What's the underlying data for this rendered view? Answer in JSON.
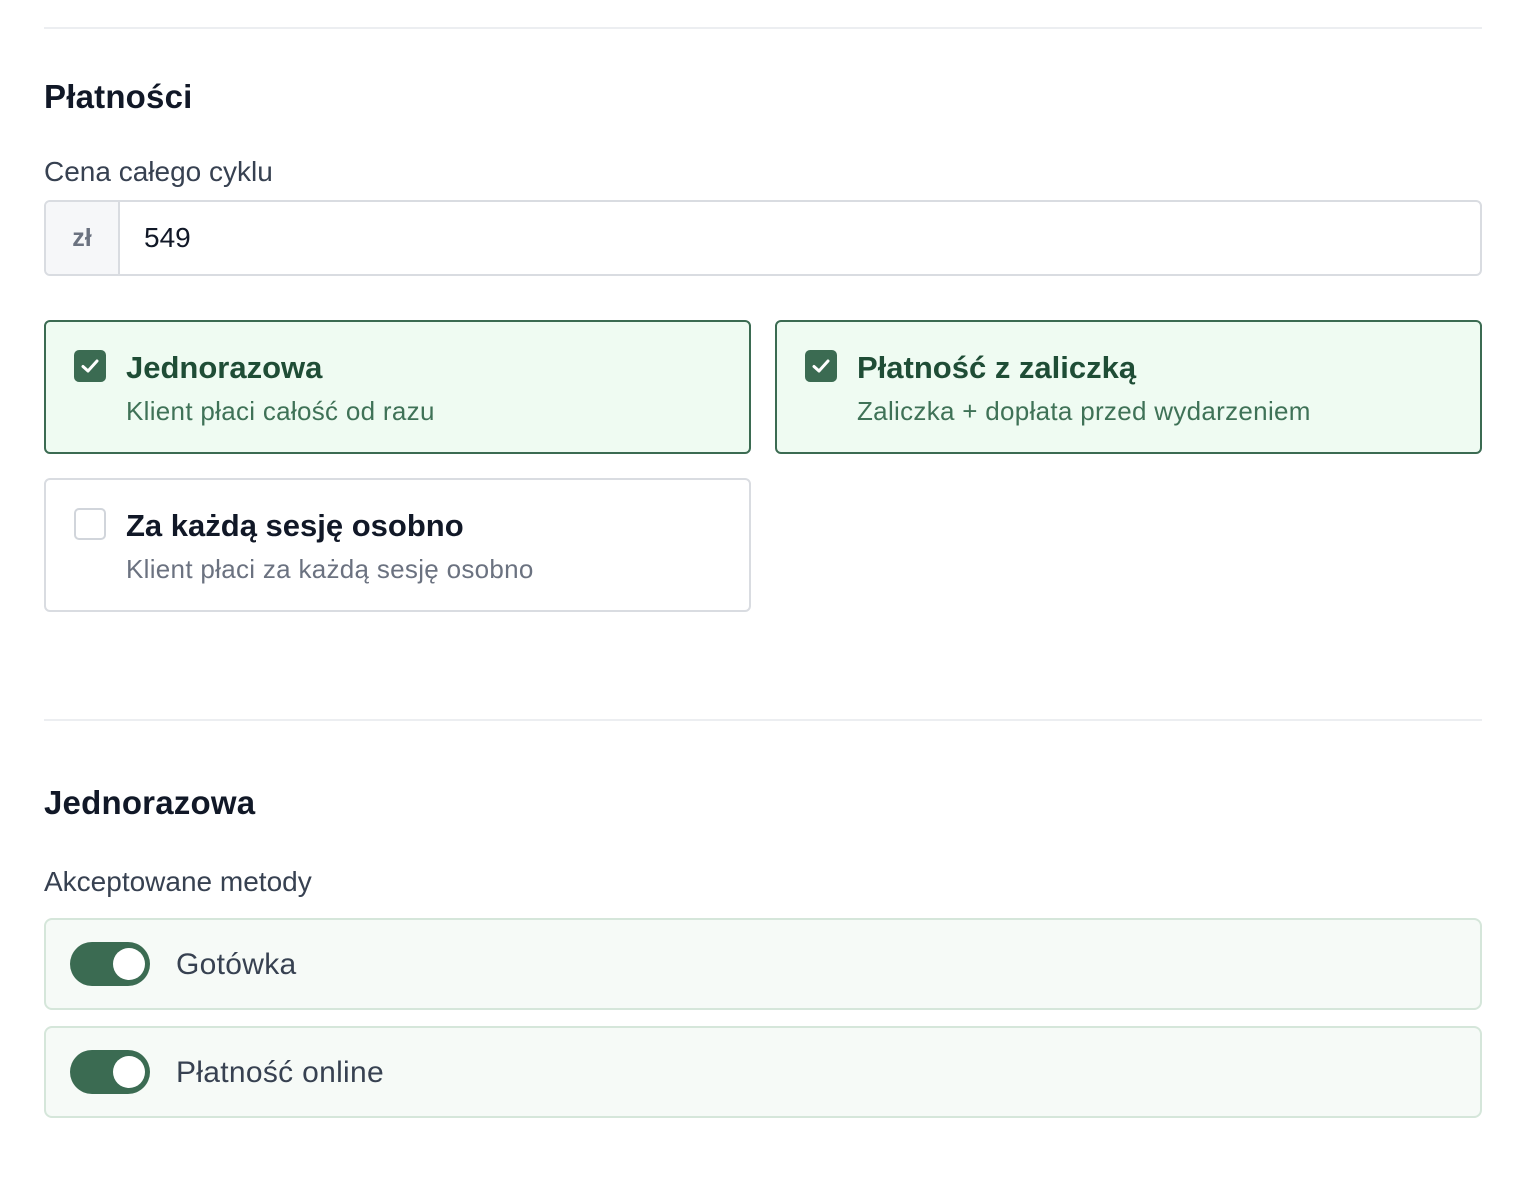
{
  "payments": {
    "section_title": "Płatności",
    "price": {
      "label": "Cena całego cyklu",
      "currency_prefix": "zł",
      "value": "549"
    },
    "options": [
      {
        "title": "Jednorazowa",
        "description": "Klient płaci całość od razu",
        "checked": true
      },
      {
        "title": "Płatność z zaliczką",
        "description": "Zaliczka + dopłata przed wydarzeniem",
        "checked": true
      },
      {
        "title": "Za każdą sesję osobno",
        "description": "Klient płaci za każdą sesję osobno",
        "checked": false
      }
    ]
  },
  "one_time": {
    "section_title": "Jednorazowa",
    "methods_label": "Akceptowane metody",
    "methods": [
      {
        "label": "Gotówka",
        "enabled": true
      },
      {
        "label": "Płatność online",
        "enabled": true
      }
    ]
  },
  "colors": {
    "accent": "#3b6b52",
    "selected_card_bg": "#effbf2",
    "method_row_bg": "#f6faf7"
  },
  "icons": [
    "checkmark-icon"
  ]
}
